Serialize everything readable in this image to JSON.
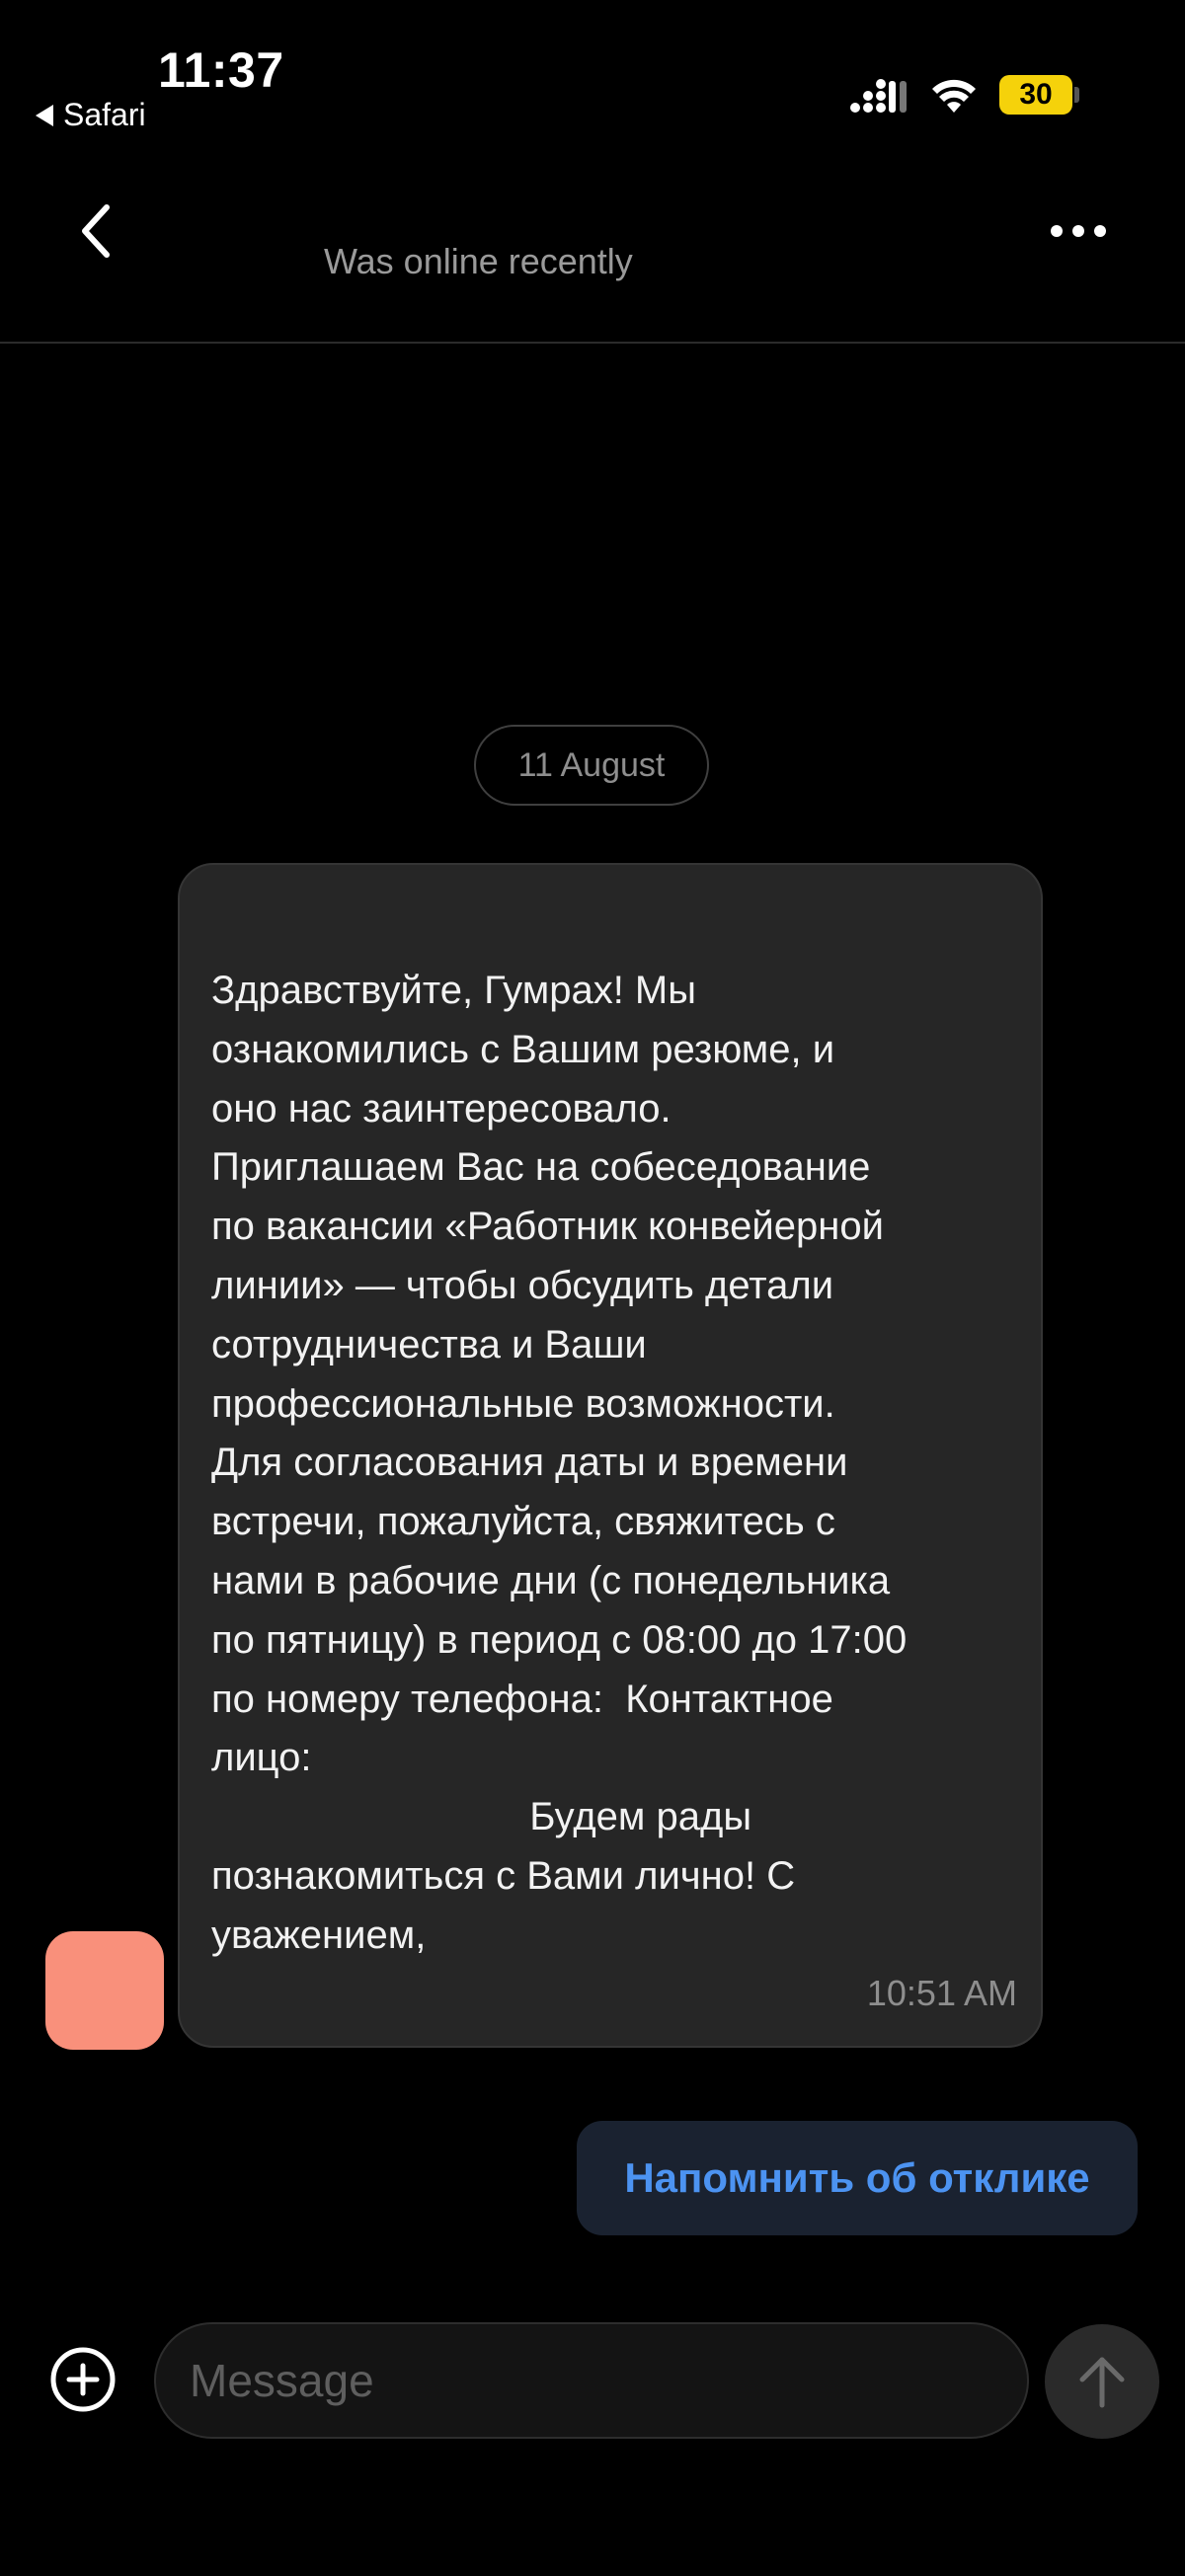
{
  "status_bar": {
    "time": "11:37",
    "back_app": "Safari",
    "battery": "30",
    "battery_color": "#f5d20b"
  },
  "header": {
    "contact_status": "Was online recently",
    "back_icon": "chevron-left-icon",
    "menu_icon": "more-horizontal-icon"
  },
  "chat": {
    "date_separator": "11 August",
    "incoming_message": {
      "text": "Здравствуйте, Гумрах! Мы\nознакомились с Вашим резюме, и\nоно нас заинтересовало.\nПриглашаем Вас на собеседование\nпо вакансии «Работник конвейерной\nлинии» — чтобы обсудить детали\nсотрудничества и Ваши\nпрофессиональные возможности.\nДля согласования даты и времени\nвстречи, пожалуйста, свяжитесь с\nнами в рабочие дни (с понедельника\nпо пятницу) в период с 08:00 до 17:00\nпо номеру телефона:  Контактное\nлицо:\n                             Будем рады\nпознакомиться с Вами лично! С\nуважением,",
      "time": "10:51 AM",
      "avatar_color": "#f9907b"
    },
    "quick_reply": "Напомнить об отклике",
    "accent_color": "#4c93f1"
  },
  "composer": {
    "placeholder": "Message",
    "value": "",
    "add_icon": "plus-circle-icon",
    "send_icon": "arrow-up-icon"
  }
}
